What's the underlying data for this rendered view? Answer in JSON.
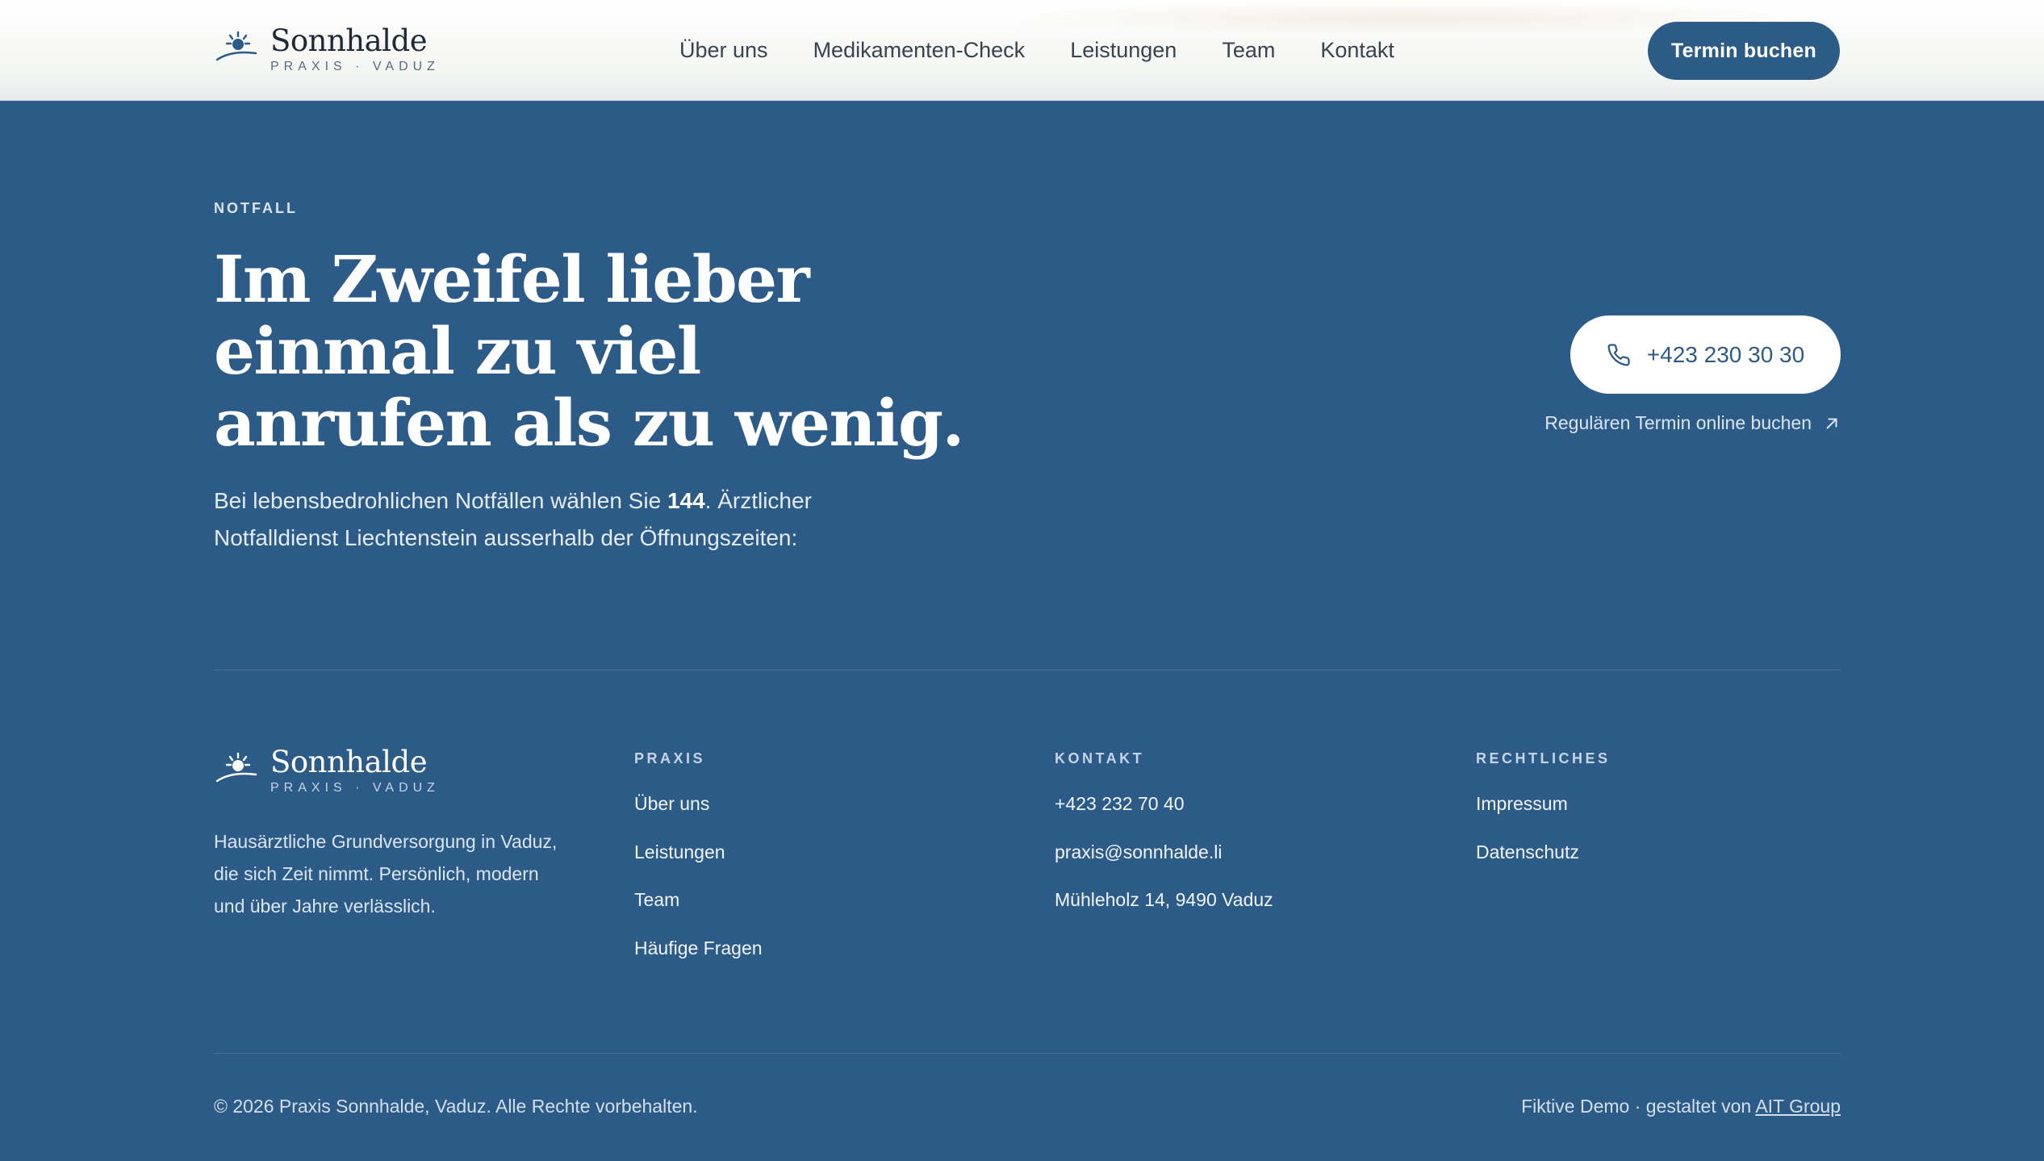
{
  "brand": {
    "name": "Sonnhalde",
    "subtitle": "PRAXIS · VADUZ"
  },
  "header": {
    "nav": [
      "Über uns",
      "Medikamenten-Check",
      "Leistungen",
      "Team",
      "Kontakt"
    ],
    "cta_label": "Termin buchen"
  },
  "emergency": {
    "eyebrow": "NOTFALL",
    "headline_lines": [
      "Im Zweifel lieber",
      "einmal zu viel",
      "anrufen als zu wenig."
    ],
    "lead_before": "Bei lebensbedrohlichen Notfällen wählen Sie ",
    "lead_number": "144",
    "lead_after": ". Ärztlicher Notfalldienst Liechtenstein ausserhalb der Öffnungszeiten:",
    "phone": "+423 230 30 30",
    "online_link": "Regulären Termin online buchen"
  },
  "footer": {
    "about": "Hausärztliche Grundversorgung in Vaduz, die sich Zeit nimmt. Persönlich, modern und über Jahre verlässlich.",
    "columns": {
      "praxis": {
        "title": "PRAXIS",
        "links": [
          "Über uns",
          "Leistungen",
          "Team",
          "Häufige Fragen"
        ]
      },
      "kontakt": {
        "title": "KONTAKT",
        "links": [
          "+423 232 70 40",
          "praxis@sonnhalde.li",
          "Mühleholz 14, 9490 Vaduz"
        ]
      },
      "rechtliches": {
        "title": "RECHTLICHES",
        "links": [
          "Impressum",
          "Datenschutz"
        ]
      }
    },
    "copyright": "© 2026 Praxis Sonnhalde, Vaduz. Alle Rechte vorbehalten.",
    "credits_prefix": "Fiktive Demo · gestaltet von ",
    "credits_link": "AIT Group"
  },
  "colors": {
    "primary": "#2d5b88",
    "header_bg": "#f4f6f3",
    "text_dark": "#1f2a36",
    "white": "#ffffff"
  },
  "icons": [
    "sun-logo-icon",
    "phone-icon",
    "arrow-up-right-icon"
  ]
}
